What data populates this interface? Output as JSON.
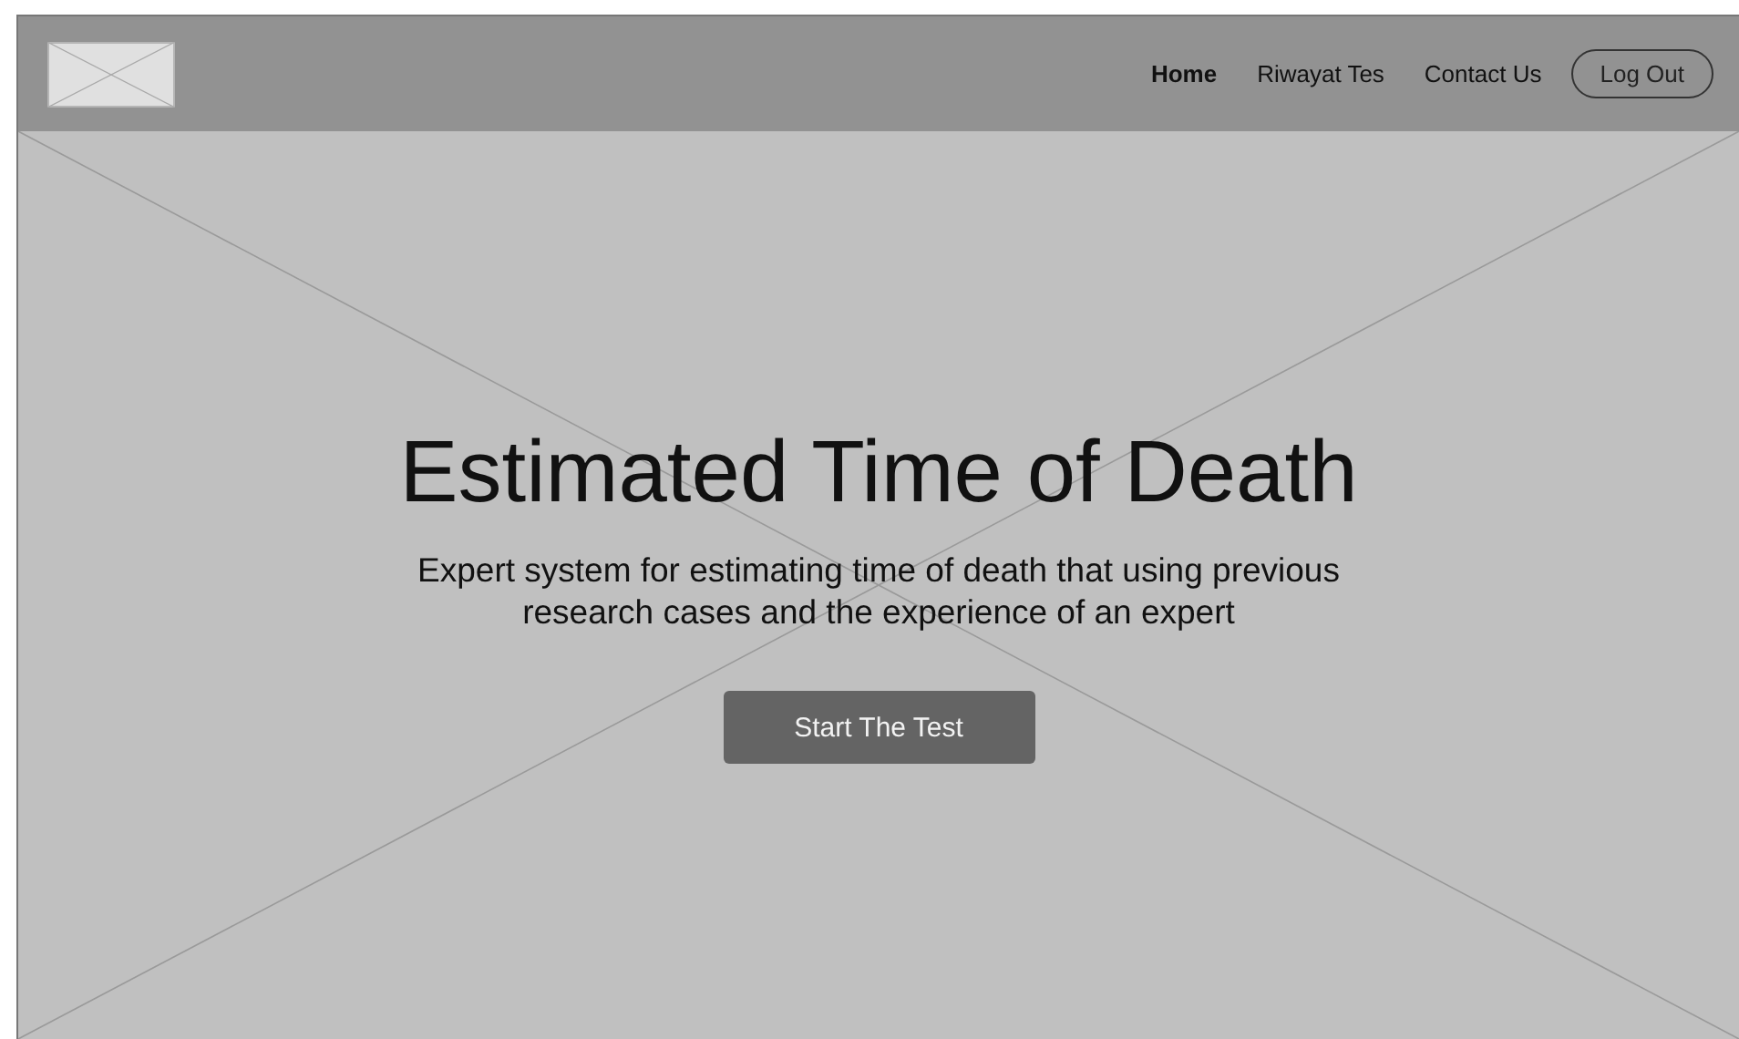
{
  "navbar": {
    "links": [
      {
        "label": "Home",
        "selected": true
      },
      {
        "label": "Riwayat Tes",
        "selected": false
      },
      {
        "label": "Contact Us",
        "selected": false
      }
    ],
    "logout_button": "Log Out"
  },
  "hero": {
    "title": "Estimated Time of Death",
    "subtitle": "Expert system for estimating time of death that using previous research cases and the experience of an expert",
    "button": "Start The Test"
  }
}
